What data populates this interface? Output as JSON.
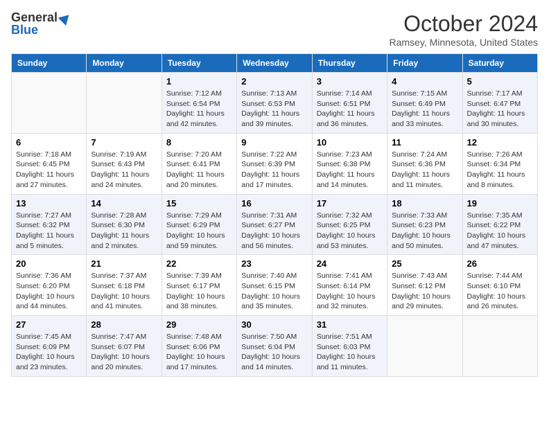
{
  "logo": {
    "general": "General",
    "blue": "Blue"
  },
  "title": "October 2024",
  "location": "Ramsey, Minnesota, United States",
  "headers": [
    "Sunday",
    "Monday",
    "Tuesday",
    "Wednesday",
    "Thursday",
    "Friday",
    "Saturday"
  ],
  "weeks": [
    {
      "days": [
        {
          "num": "",
          "detail": ""
        },
        {
          "num": "",
          "detail": ""
        },
        {
          "num": "1",
          "detail": "Sunrise: 7:12 AM\nSunset: 6:54 PM\nDaylight: 11 hours and 42 minutes."
        },
        {
          "num": "2",
          "detail": "Sunrise: 7:13 AM\nSunset: 6:53 PM\nDaylight: 11 hours and 39 minutes."
        },
        {
          "num": "3",
          "detail": "Sunrise: 7:14 AM\nSunset: 6:51 PM\nDaylight: 11 hours and 36 minutes."
        },
        {
          "num": "4",
          "detail": "Sunrise: 7:15 AM\nSunset: 6:49 PM\nDaylight: 11 hours and 33 minutes."
        },
        {
          "num": "5",
          "detail": "Sunrise: 7:17 AM\nSunset: 6:47 PM\nDaylight: 11 hours and 30 minutes."
        }
      ]
    },
    {
      "days": [
        {
          "num": "6",
          "detail": "Sunrise: 7:18 AM\nSunset: 6:45 PM\nDaylight: 11 hours and 27 minutes."
        },
        {
          "num": "7",
          "detail": "Sunrise: 7:19 AM\nSunset: 6:43 PM\nDaylight: 11 hours and 24 minutes."
        },
        {
          "num": "8",
          "detail": "Sunrise: 7:20 AM\nSunset: 6:41 PM\nDaylight: 11 hours and 20 minutes."
        },
        {
          "num": "9",
          "detail": "Sunrise: 7:22 AM\nSunset: 6:39 PM\nDaylight: 11 hours and 17 minutes."
        },
        {
          "num": "10",
          "detail": "Sunrise: 7:23 AM\nSunset: 6:38 PM\nDaylight: 11 hours and 14 minutes."
        },
        {
          "num": "11",
          "detail": "Sunrise: 7:24 AM\nSunset: 6:36 PM\nDaylight: 11 hours and 11 minutes."
        },
        {
          "num": "12",
          "detail": "Sunrise: 7:26 AM\nSunset: 6:34 PM\nDaylight: 11 hours and 8 minutes."
        }
      ]
    },
    {
      "days": [
        {
          "num": "13",
          "detail": "Sunrise: 7:27 AM\nSunset: 6:32 PM\nDaylight: 11 hours and 5 minutes."
        },
        {
          "num": "14",
          "detail": "Sunrise: 7:28 AM\nSunset: 6:30 PM\nDaylight: 11 hours and 2 minutes."
        },
        {
          "num": "15",
          "detail": "Sunrise: 7:29 AM\nSunset: 6:29 PM\nDaylight: 10 hours and 59 minutes."
        },
        {
          "num": "16",
          "detail": "Sunrise: 7:31 AM\nSunset: 6:27 PM\nDaylight: 10 hours and 56 minutes."
        },
        {
          "num": "17",
          "detail": "Sunrise: 7:32 AM\nSunset: 6:25 PM\nDaylight: 10 hours and 53 minutes."
        },
        {
          "num": "18",
          "detail": "Sunrise: 7:33 AM\nSunset: 6:23 PM\nDaylight: 10 hours and 50 minutes."
        },
        {
          "num": "19",
          "detail": "Sunrise: 7:35 AM\nSunset: 6:22 PM\nDaylight: 10 hours and 47 minutes."
        }
      ]
    },
    {
      "days": [
        {
          "num": "20",
          "detail": "Sunrise: 7:36 AM\nSunset: 6:20 PM\nDaylight: 10 hours and 44 minutes."
        },
        {
          "num": "21",
          "detail": "Sunrise: 7:37 AM\nSunset: 6:18 PM\nDaylight: 10 hours and 41 minutes."
        },
        {
          "num": "22",
          "detail": "Sunrise: 7:39 AM\nSunset: 6:17 PM\nDaylight: 10 hours and 38 minutes."
        },
        {
          "num": "23",
          "detail": "Sunrise: 7:40 AM\nSunset: 6:15 PM\nDaylight: 10 hours and 35 minutes."
        },
        {
          "num": "24",
          "detail": "Sunrise: 7:41 AM\nSunset: 6:14 PM\nDaylight: 10 hours and 32 minutes."
        },
        {
          "num": "25",
          "detail": "Sunrise: 7:43 AM\nSunset: 6:12 PM\nDaylight: 10 hours and 29 minutes."
        },
        {
          "num": "26",
          "detail": "Sunrise: 7:44 AM\nSunset: 6:10 PM\nDaylight: 10 hours and 26 minutes."
        }
      ]
    },
    {
      "days": [
        {
          "num": "27",
          "detail": "Sunrise: 7:45 AM\nSunset: 6:09 PM\nDaylight: 10 hours and 23 minutes."
        },
        {
          "num": "28",
          "detail": "Sunrise: 7:47 AM\nSunset: 6:07 PM\nDaylight: 10 hours and 20 minutes."
        },
        {
          "num": "29",
          "detail": "Sunrise: 7:48 AM\nSunset: 6:06 PM\nDaylight: 10 hours and 17 minutes."
        },
        {
          "num": "30",
          "detail": "Sunrise: 7:50 AM\nSunset: 6:04 PM\nDaylight: 10 hours and 14 minutes."
        },
        {
          "num": "31",
          "detail": "Sunrise: 7:51 AM\nSunset: 6:03 PM\nDaylight: 10 hours and 11 minutes."
        },
        {
          "num": "",
          "detail": ""
        },
        {
          "num": "",
          "detail": ""
        }
      ]
    }
  ]
}
